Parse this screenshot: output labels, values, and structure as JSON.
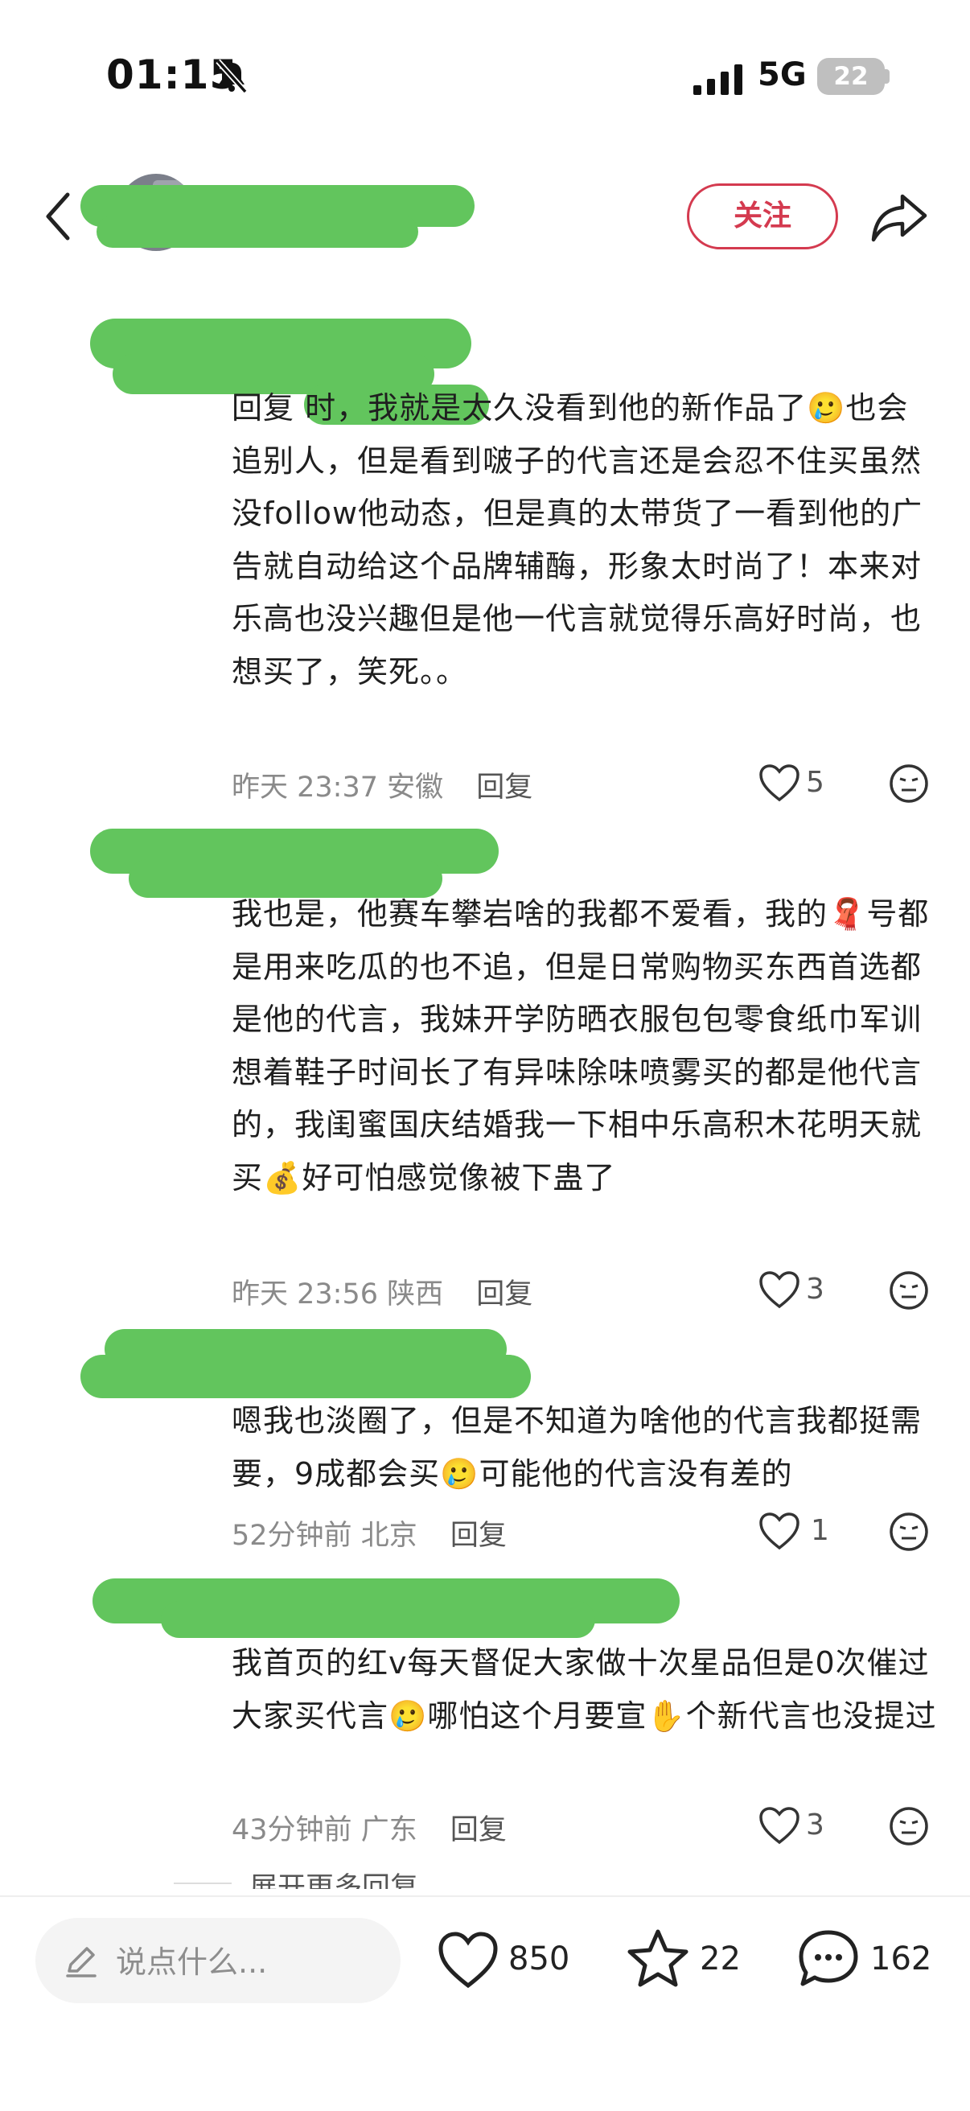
{
  "status_bar": {
    "time": "01:15",
    "network": "5G",
    "battery": "22"
  },
  "header": {
    "follow_label": "关注"
  },
  "comments": [
    {
      "text": "回复        时，我就是太久没看到他的新作品了🥲也会追别人，但是看到啵子的代言还是会忍不住买虽然没follow他动态，但是真的太带货了一看到他的广告就自动给这个品牌辅酶，形象太时尚了！本来对乐高也没兴趣但是他一代言就觉得乐高好时尚，也想买了，笑死。。",
      "time": "昨天 23:37",
      "location": "安徽",
      "reply": "回复",
      "likes": "5"
    },
    {
      "text": "我也是，他赛车攀岩啥的我都不爱看，我的🧣号都是用来吃瓜的也不追，但是日常购物买东西首选都是他的代言，我妹开学防晒衣服包包零食纸巾军训想着鞋子时间长了有异味除味喷雾买的都是他代言的，我闺蜜国庆结婚我一下相中乐高积木花明天就买💰好可怕感觉像被下蛊了",
      "time": "昨天 23:56",
      "location": "陕西",
      "reply": "回复",
      "likes": "3"
    },
    {
      "text": "嗯我也淡圈了，但是不知道为啥他的代言我都挺需要，9成都会买🥲可能他的代言没有差的",
      "time": "52分钟前",
      "location": "北京",
      "reply": "回复",
      "likes": "1"
    },
    {
      "text": "我首页的红v每天督促大家做十次星品但是0次催过大家买代言🥲哪怕这个月要宣✋个新代言也没提过",
      "time": "43分钟前",
      "location": "广东",
      "reply": "回复",
      "likes": "3"
    }
  ],
  "more_replies": "展开更多回复",
  "bottom_bar": {
    "input_placeholder": "说点什么...",
    "likes": "850",
    "favorites": "22",
    "comments": "162"
  }
}
